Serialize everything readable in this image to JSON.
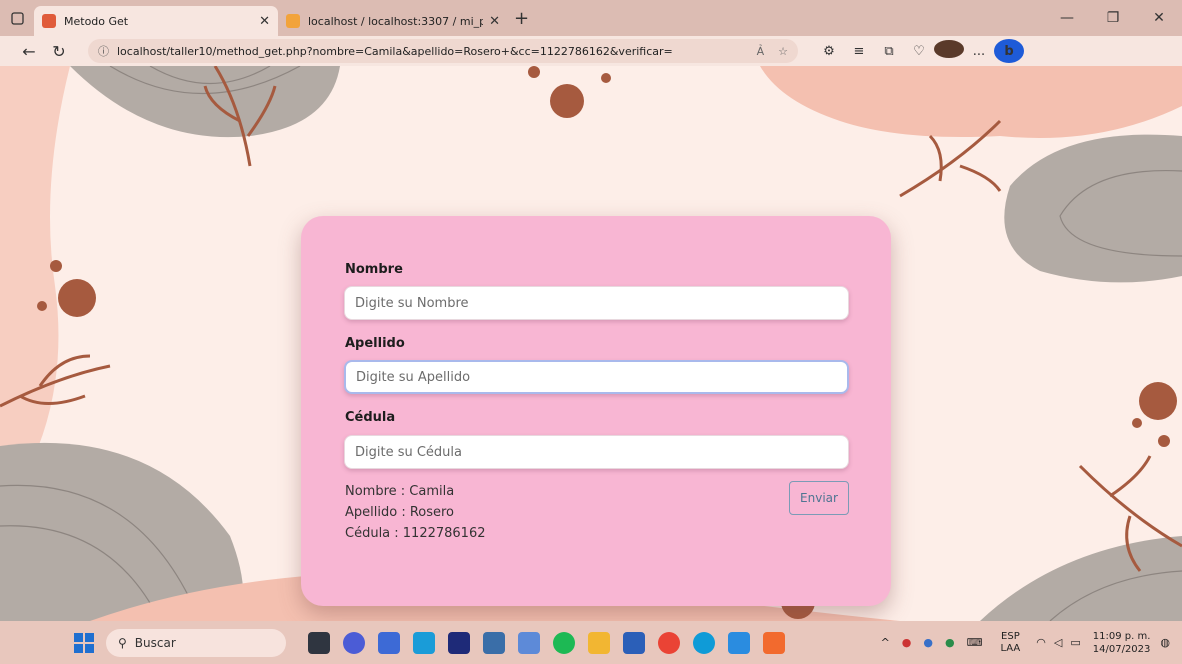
{
  "browser": {
    "tabs": [
      {
        "title": "Metodo Get",
        "active": true
      },
      {
        "title": "localhost / localhost:3307 / mi_p",
        "active": false
      }
    ],
    "url": "localhost/taller10/method_get.php?nombre=Camila&apellido=Rosero+&cc=1122786162&verificar=",
    "read_aloud": "Ả",
    "more": "..."
  },
  "form": {
    "nombre_label": "Nombre",
    "nombre_placeholder": "Digite su Nombre",
    "apellido_label": "Apellido",
    "apellido_placeholder": "Digite su Apellido",
    "cedula_label": "Cédula",
    "cedula_placeholder": "Digite su Cédula",
    "submit_label": "Enviar"
  },
  "result": {
    "nombre": "Nombre : Camila",
    "apellido": "Apellido : Rosero",
    "cedula": "Cédula : 1122786162"
  },
  "taskbar": {
    "search_label": "Buscar",
    "lang_top": "ESP",
    "lang_bottom": "LAA",
    "time": "11:09 p. m.",
    "date": "14/07/2023"
  },
  "colors": {
    "card": "#f8b6d3",
    "background": "#fdeee8",
    "accent_brown": "#a65a3f",
    "accent_gray": "#b3aba5"
  }
}
